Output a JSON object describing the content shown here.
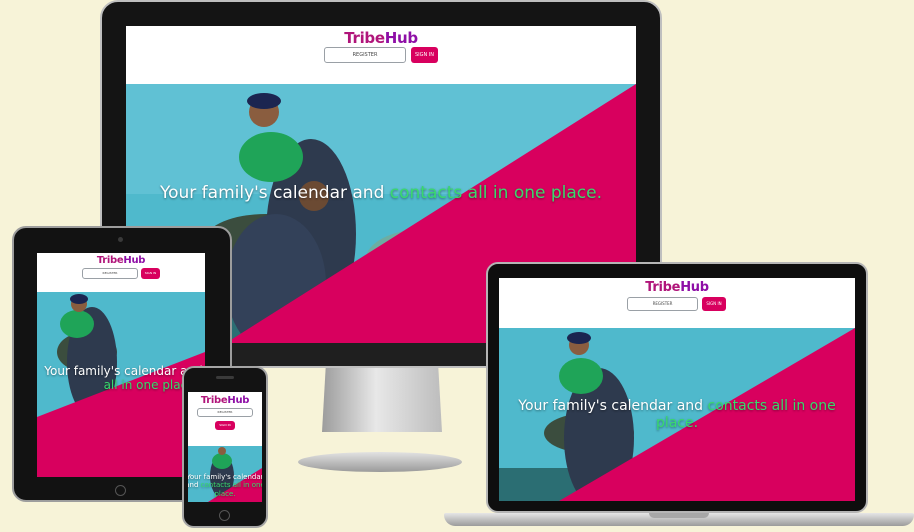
{
  "brand": {
    "name_part1": "Tribe",
    "name_part2": "Hub"
  },
  "nav": {
    "register_label": "REGISTER",
    "signin_label": "SIGN IN"
  },
  "hero": {
    "tagline_white": "Your family's calendar and",
    "tagline_green": "contacts all in one place."
  },
  "colors": {
    "background": "#f7f3d8",
    "brand_pink": "#b0157a",
    "brand_purple": "#8e0fa6",
    "signin_button": "#d8005e",
    "hero_magenta": "#d8005e",
    "sky": "#4fb9cc",
    "accent_green": "#39d96d"
  }
}
